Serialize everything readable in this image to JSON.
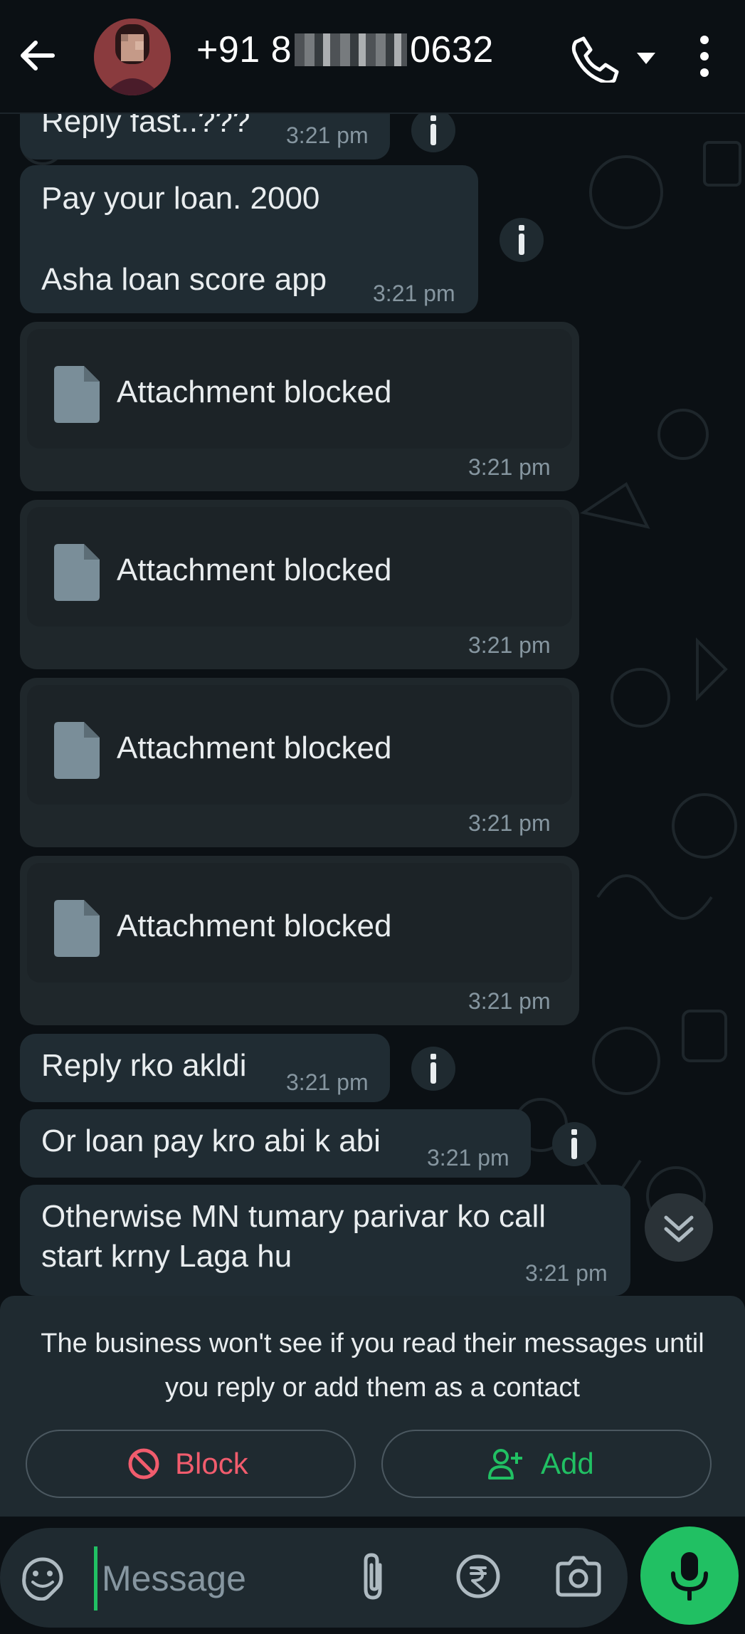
{
  "header": {
    "title_prefix": "+91 8",
    "title_suffix": "0632"
  },
  "messages": [
    {
      "text": "Reply fast..???",
      "time": "3:21 pm"
    },
    {
      "line1": "Pay your loan. 2000",
      "line2": "Asha loan score app",
      "time": "3:21 pm"
    },
    {
      "label": "Attachment blocked",
      "time": "3:21 pm"
    },
    {
      "label": "Attachment blocked",
      "time": "3:21 pm"
    },
    {
      "label": "Attachment blocked",
      "time": "3:21 pm"
    },
    {
      "label": "Attachment blocked",
      "time": "3:21 pm"
    },
    {
      "text": "Reply rko akldi",
      "time": "3:21 pm"
    },
    {
      "text": "Or loan pay kro abi k abi",
      "time": "3:21 pm"
    },
    {
      "line1": "Otherwise MN tumary parivar ko call",
      "line2": "start krny Laga hu",
      "time": "3:21 pm"
    }
  ],
  "banner": {
    "text": "The business won't see if you read their messages until you reply or add them as a contact",
    "block_label": "Block",
    "add_label": "Add"
  },
  "composer": {
    "placeholder": "Message"
  },
  "colors": {
    "accent": "#21c063",
    "danger": "#f15c6d",
    "bubble": "#202c33",
    "background": "#0b1014"
  }
}
